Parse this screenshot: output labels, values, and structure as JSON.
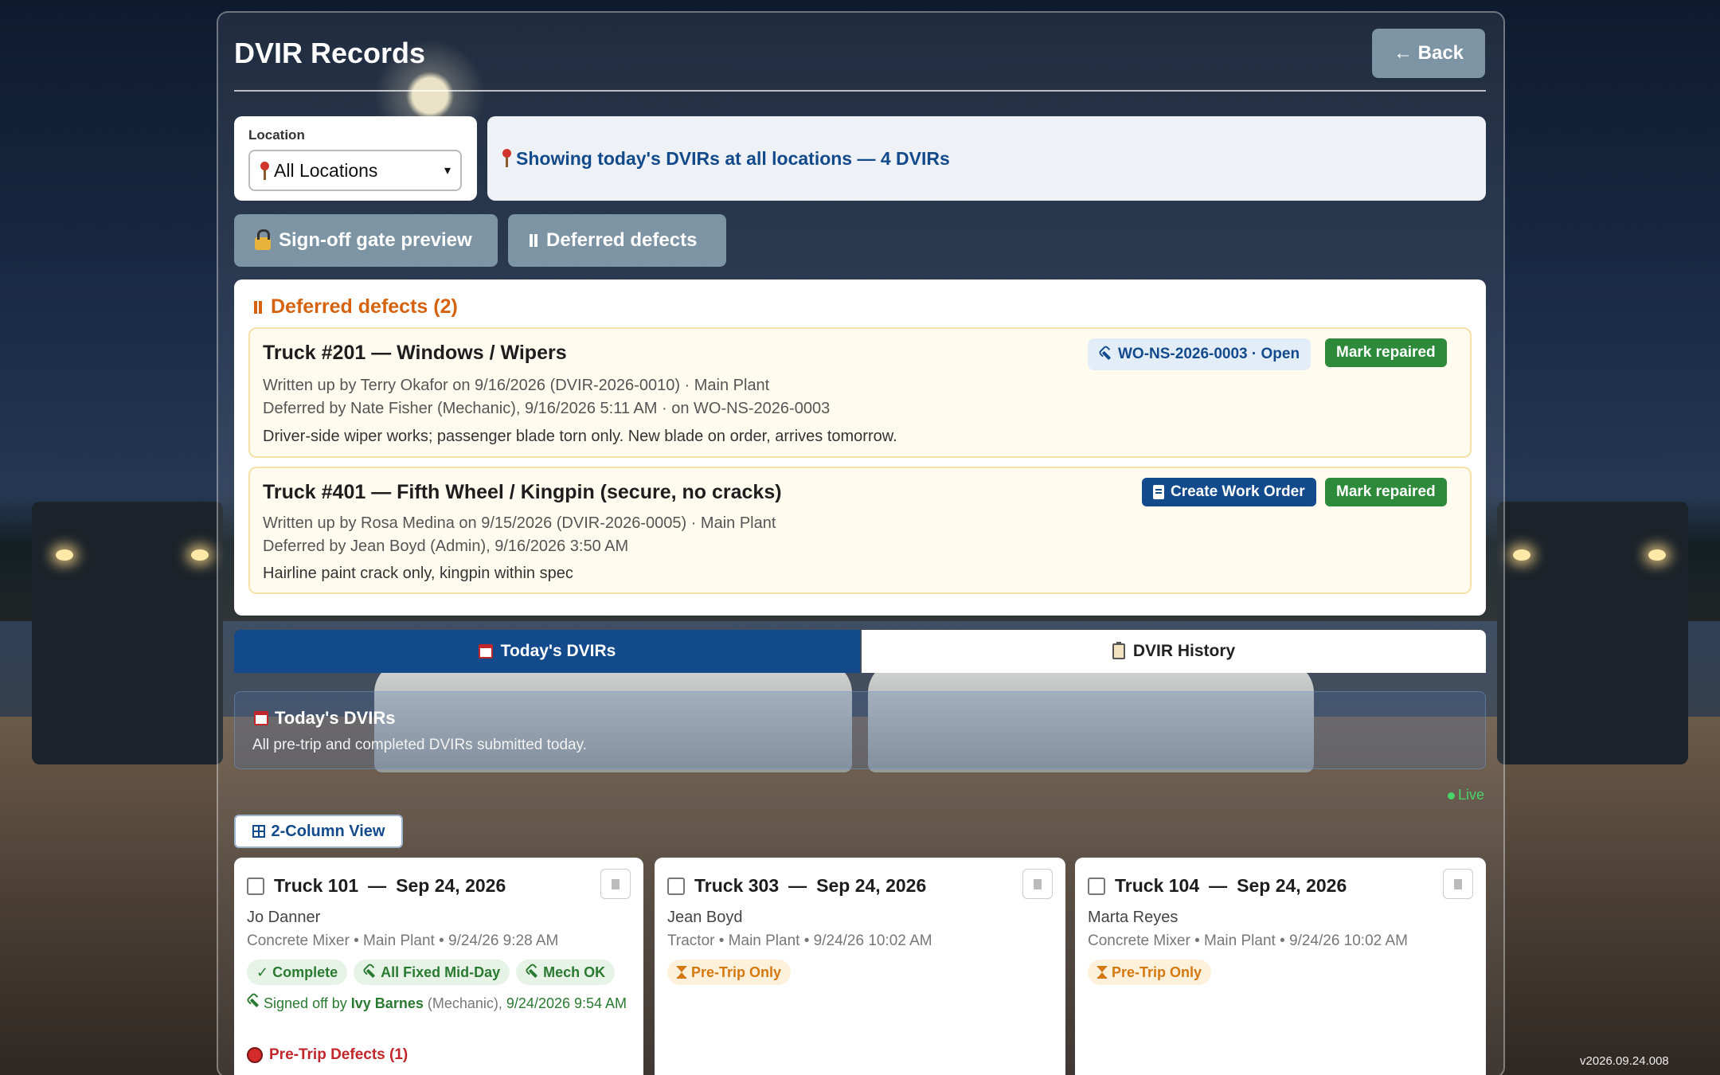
{
  "page": {
    "title": "DVIR Records",
    "back_label": "← Back",
    "version": "v2026.09.24.008"
  },
  "location": {
    "label": "Location",
    "selected": "All Locations"
  },
  "status": {
    "text": "Showing today's DVIRs at all locations — 4 DVIRs"
  },
  "toolbar": {
    "signoff_label": "Sign-off gate preview",
    "deferred_label": "Deferred defects"
  },
  "deferred": {
    "heading": "Deferred defects (2)",
    "items": [
      {
        "title": "Truck #201 — Windows / Wipers",
        "written": "Written up by Terry Okafor on 9/16/2026 (DVIR-2026-0010) · Main Plant",
        "deferred": "Deferred by Nate Fisher (Mechanic), 9/16/2026 5:11 AM · on WO-NS-2026-0003",
        "note": "Driver-side wiper works; passenger blade torn only. New blade on order, arrives tomorrow.",
        "wo_label": "WO-NS-2026-0003 · Open",
        "mark_label": "Mark repaired"
      },
      {
        "title": "Truck #401 — Fifth Wheel / Kingpin (secure, no cracks)",
        "written": "Written up by Rosa Medina on 9/15/2026 (DVIR-2026-0005) · Main Plant",
        "deferred": "Deferred by Jean Boyd (Admin), 9/16/2026 3:50 AM",
        "note": "Hairline paint crack only, kingpin within spec",
        "create_label": "Create Work Order",
        "mark_label": "Mark repaired"
      }
    ]
  },
  "tabs": [
    {
      "label": "Today's DVIRs",
      "active": true
    },
    {
      "label": "DVIR History",
      "active": false
    }
  ],
  "today": {
    "title": "Today's DVIRs",
    "subtitle": "All pre-trip and completed DVIRs submitted today.",
    "live_label": "Live"
  },
  "view_toggle": {
    "label": "2-Column View"
  },
  "records": [
    {
      "truck": "Truck 101",
      "sep": "—",
      "date": "Sep 24, 2026",
      "driver": "Jo Danner",
      "meta": "Concrete Mixer • Main Plant • 9/24/26 9:28 AM",
      "chips": [
        "✓ Complete",
        "All Fixed Mid-Day",
        "Mech OK"
      ],
      "signed_prefix": "Signed off by",
      "signed_name": "Ivy Barnes",
      "signed_role": "(Mechanic),",
      "signed_time": "9/24/2026 9:54 AM",
      "pretrip_defects": "Pre-Trip Defects (1)"
    },
    {
      "truck": "Truck 303",
      "sep": "—",
      "date": "Sep 24, 2026",
      "driver": "Jean Boyd",
      "meta": "Tractor • Main Plant • 9/24/26 10:02 AM",
      "status_chip": "Pre-Trip Only"
    },
    {
      "truck": "Truck 104",
      "sep": "—",
      "date": "Sep 24, 2026",
      "driver": "Marta Reyes",
      "meta": "Concrete Mixer • Main Plant • 9/24/26 10:02 AM",
      "status_chip": "Pre-Trip Only"
    }
  ],
  "colors": {
    "primary": "#124a8c",
    "success": "#2d8a3a",
    "warning": "#d5620f",
    "danger": "#c0262a",
    "button_gray": "#7c94a3"
  }
}
